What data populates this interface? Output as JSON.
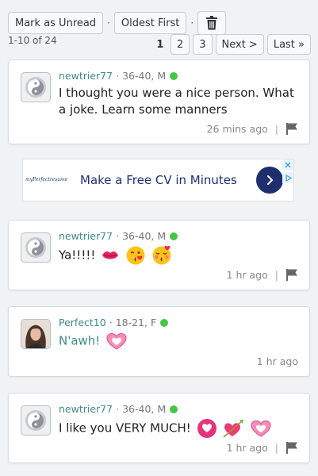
{
  "toolbar": {
    "mark_unread_label": "Mark as Unread",
    "separator": "·",
    "sort_label": "Oldest First"
  },
  "range_text": "1-10 of 24",
  "pagination": {
    "current": "1",
    "pages": [
      "2",
      "3"
    ],
    "next_label": "Next >",
    "last_label": "Last »"
  },
  "ad": {
    "logo_text": "myPerfectresume",
    "headline": "Make a Free CV in Minutes"
  },
  "messages": [
    {
      "username": "newtrier77",
      "age_gender": "36-40, M",
      "text": "I thought you were a nice person. What a joke. Learn some manners",
      "time": "26 mins ago",
      "separator": "|",
      "flag_icon": "flag-icon"
    },
    {
      "username": "newtrier77",
      "age_gender": "36-40, M",
      "text": "Ya!!!!!",
      "emojis": [
        "kiss-mark-emoji",
        "face-blowing-kiss-emoji",
        "kissing-face-closed-eyes-emoji"
      ],
      "time": "1 hr ago",
      "separator": "|",
      "flag_icon": "flag-icon"
    },
    {
      "username": "Perfect10",
      "age_gender": "18-21, F",
      "text": "N'awh!",
      "emojis": [
        "heart-with-ribbon-emoji"
      ],
      "time": "1 hr ago"
    },
    {
      "username": "newtrier77",
      "age_gender": "36-40, M",
      "text": "I like you VERY MUCH!",
      "emojis": [
        "heart-decoration-emoji",
        "heart-with-arrow-emoji",
        "heart-with-ribbon-emoji"
      ],
      "time": "1 hr ago",
      "separator": "|",
      "flag_icon": "flag-icon"
    }
  ],
  "colors": {
    "username": "#3f8a87",
    "online": "#45c646",
    "ad_brand": "#1f2f6e"
  }
}
